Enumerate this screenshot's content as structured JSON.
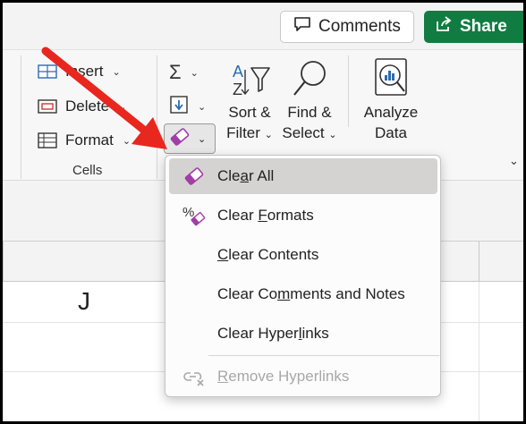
{
  "header": {
    "comments_label": "Comments",
    "share_label": "Share"
  },
  "ribbon": {
    "cells": {
      "insert_label": "Insert",
      "delete_label": "Delete",
      "format_label": "Format",
      "group_label": "Cells"
    },
    "sort_filter": {
      "line1": "Sort &",
      "line2": "Filter"
    },
    "find_select": {
      "line1": "Find &",
      "line2": "Select"
    },
    "analyze_data": {
      "line1": "Analyze",
      "line2": "Data"
    }
  },
  "sheet": {
    "column_header": "J"
  },
  "clear_menu": {
    "items": [
      {
        "pre": "Cle",
        "ul": "a",
        "post": "r All",
        "icon": "eraser-icon",
        "selected": true,
        "disabled": false
      },
      {
        "pre": "Clear ",
        "ul": "F",
        "post": "ormats",
        "icon": "clear-formats-icon",
        "selected": false,
        "disabled": false
      },
      {
        "pre": "",
        "ul": "C",
        "post": "lear Contents",
        "icon": "",
        "selected": false,
        "disabled": false
      },
      {
        "pre": "Clear Co",
        "ul": "m",
        "post": "ments and Notes",
        "icon": "",
        "selected": false,
        "disabled": false
      },
      {
        "pre": "Clear Hyper",
        "ul": "l",
        "post": "inks",
        "icon": "",
        "selected": false,
        "disabled": false
      },
      {
        "pre": "",
        "ul": "R",
        "post": "emove Hyperlinks",
        "icon": "remove-link-icon",
        "selected": false,
        "disabled": true
      }
    ]
  },
  "colors": {
    "share_green": "#107c41",
    "eraser_purple": "#a23ea8",
    "arrow_red": "#e8271f"
  }
}
